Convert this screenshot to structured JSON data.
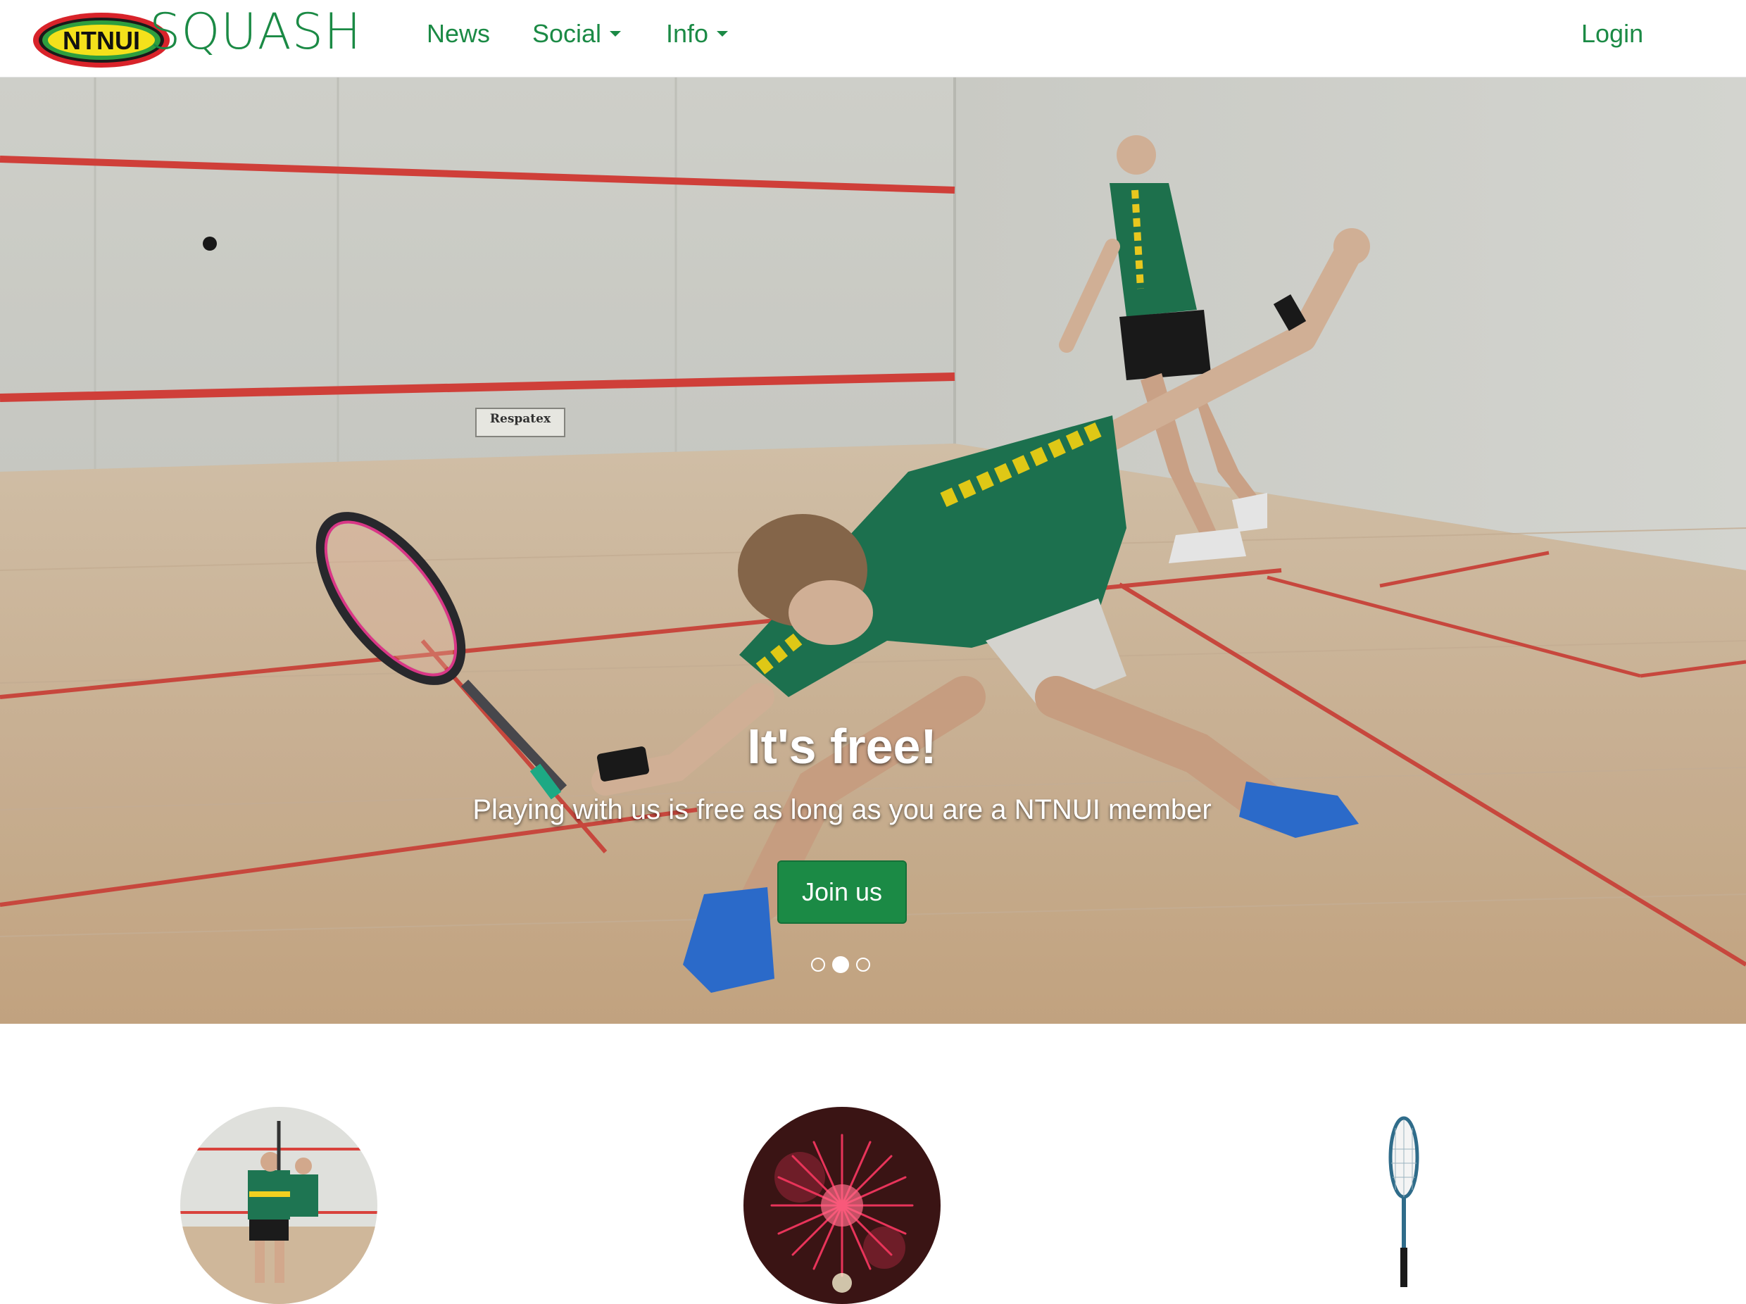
{
  "navbar": {
    "logo_text": "NTNUI",
    "brand_name": "SQUASH",
    "items": [
      {
        "label": "News",
        "dropdown": false
      },
      {
        "label": "Social",
        "dropdown": true
      },
      {
        "label": "Info",
        "dropdown": true
      }
    ],
    "login_label": "Login"
  },
  "carousel": {
    "title": "It's free!",
    "text": "Playing with us is free as long as you are a NTNUI member",
    "button_label": "Join us",
    "slide_count": 3,
    "active_slide": 2,
    "court_sign": "Respatex"
  },
  "features": [
    {
      "image": "players-on-court"
    },
    {
      "image": "fireworks"
    },
    {
      "image": "squash-racket"
    }
  ],
  "colors": {
    "brand_green": "#1b8a45",
    "logo_red": "#d8232a",
    "logo_yellow": "#f4e11b"
  }
}
